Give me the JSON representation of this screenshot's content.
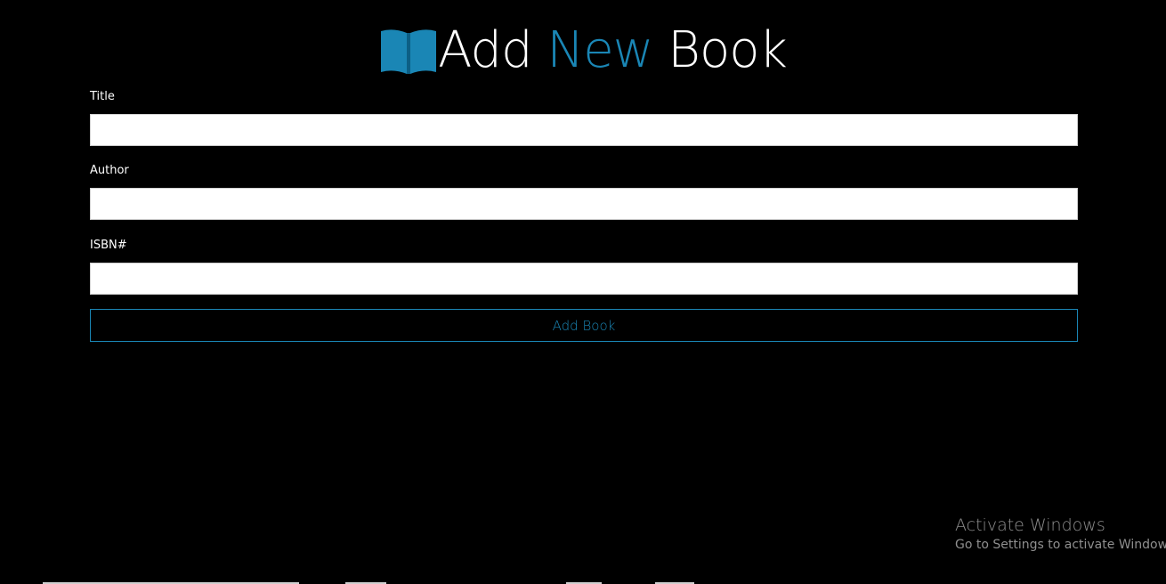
{
  "header": {
    "title_part1": "Add ",
    "title_accent": "New",
    "title_part2": " Book",
    "icon": "open-book-icon",
    "accent_color": "#1a86b5"
  },
  "form": {
    "title_label": "Title",
    "title_value": "",
    "author_label": "Author",
    "author_value": "",
    "isbn_label": "ISBN#",
    "isbn_value": "",
    "submit_label": "Add Book"
  },
  "watermark": {
    "title": "Activate Windows",
    "subtitle": "Go to Settings to activate Windows."
  }
}
